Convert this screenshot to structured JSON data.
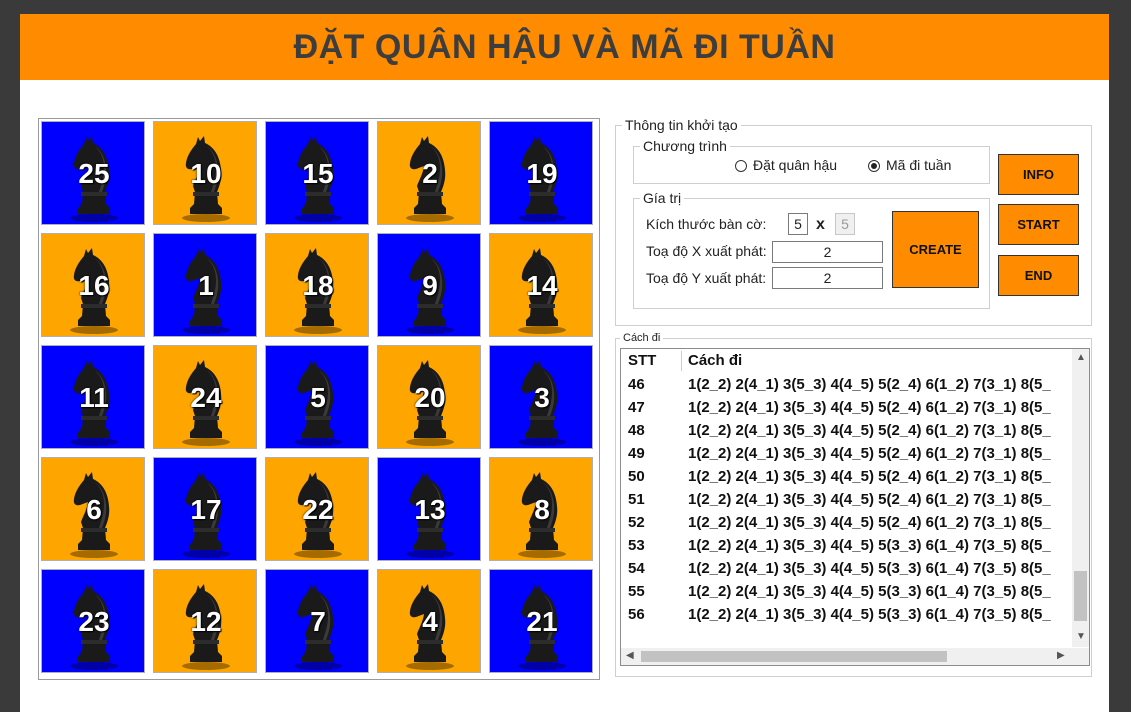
{
  "title": "ĐẶT QUÂN HẬU VÀ MÃ ĐI TUẦN",
  "board": {
    "cells": [
      {
        "n": "25",
        "color": "blue"
      },
      {
        "n": "10",
        "color": "orange"
      },
      {
        "n": "15",
        "color": "blue"
      },
      {
        "n": "2",
        "color": "orange"
      },
      {
        "n": "19",
        "color": "blue"
      },
      {
        "n": "16",
        "color": "orange"
      },
      {
        "n": "1",
        "color": "blue"
      },
      {
        "n": "18",
        "color": "orange"
      },
      {
        "n": "9",
        "color": "blue"
      },
      {
        "n": "14",
        "color": "orange"
      },
      {
        "n": "11",
        "color": "blue"
      },
      {
        "n": "24",
        "color": "orange"
      },
      {
        "n": "5",
        "color": "blue"
      },
      {
        "n": "20",
        "color": "orange"
      },
      {
        "n": "3",
        "color": "blue"
      },
      {
        "n": "6",
        "color": "orange"
      },
      {
        "n": "17",
        "color": "blue"
      },
      {
        "n": "22",
        "color": "orange"
      },
      {
        "n": "13",
        "color": "blue"
      },
      {
        "n": "8",
        "color": "orange"
      },
      {
        "n": "23",
        "color": "blue"
      },
      {
        "n": "12",
        "color": "orange"
      },
      {
        "n": "7",
        "color": "blue"
      },
      {
        "n": "4",
        "color": "orange"
      },
      {
        "n": "21",
        "color": "blue"
      }
    ],
    "piece_icon": "knight-icon"
  },
  "init_group": {
    "legend": "Thông tin khởi tạo",
    "program": {
      "legend": "Chương trình",
      "option_queen": "Đặt quân hậu",
      "option_knight": "Mã đi tuần",
      "selected": "Mã đi tuần"
    },
    "values": {
      "legend": "Gía trị",
      "size_label": "Kích thước bàn cờ:",
      "size_rows": "5",
      "size_x": "x",
      "size_cols": "5",
      "start_x_label": "Toạ độ X xuất phát:",
      "start_x": "2",
      "start_y_label": "Toạ độ Y xuất phát:",
      "start_y": "2"
    },
    "create_label": "CREATE"
  },
  "buttons": {
    "info": "INFO",
    "start": "START",
    "end": "END"
  },
  "moves_group": {
    "legend": "Cách đi",
    "columns": [
      "STT",
      "Cách đi"
    ],
    "rows": [
      {
        "stt": "46",
        "moves": "1(2_2) 2(4_1) 3(5_3) 4(4_5) 5(2_4) 6(1_2) 7(3_1) 8(5_"
      },
      {
        "stt": "47",
        "moves": "1(2_2) 2(4_1) 3(5_3) 4(4_5) 5(2_4) 6(1_2) 7(3_1) 8(5_"
      },
      {
        "stt": "48",
        "moves": "1(2_2) 2(4_1) 3(5_3) 4(4_5) 5(2_4) 6(1_2) 7(3_1) 8(5_"
      },
      {
        "stt": "49",
        "moves": "1(2_2) 2(4_1) 3(5_3) 4(4_5) 5(2_4) 6(1_2) 7(3_1) 8(5_"
      },
      {
        "stt": "50",
        "moves": "1(2_2) 2(4_1) 3(5_3) 4(4_5) 5(2_4) 6(1_2) 7(3_1) 8(5_"
      },
      {
        "stt": "51",
        "moves": "1(2_2) 2(4_1) 3(5_3) 4(4_5) 5(2_4) 6(1_2) 7(3_1) 8(5_"
      },
      {
        "stt": "52",
        "moves": "1(2_2) 2(4_1) 3(5_3) 4(4_5) 5(2_4) 6(1_2) 7(3_1) 8(5_"
      },
      {
        "stt": "53",
        "moves": "1(2_2) 2(4_1) 3(5_3) 4(4_5) 5(3_3) 6(1_4) 7(3_5) 8(5_"
      },
      {
        "stt": "54",
        "moves": "1(2_2) 2(4_1) 3(5_3) 4(4_5) 5(3_3) 6(1_4) 7(3_5) 8(5_"
      },
      {
        "stt": "55",
        "moves": "1(2_2) 2(4_1) 3(5_3) 4(4_5) 5(3_3) 6(1_4) 7(3_5) 8(5_"
      },
      {
        "stt": "56",
        "moves": "1(2_2) 2(4_1) 3(5_3) 4(4_5) 5(3_3) 6(1_4) 7(3_5) 8(5_"
      }
    ]
  },
  "colors": {
    "accent": "#ff8c00",
    "cell_blue": "#0000ff",
    "cell_orange": "#ffa500"
  }
}
